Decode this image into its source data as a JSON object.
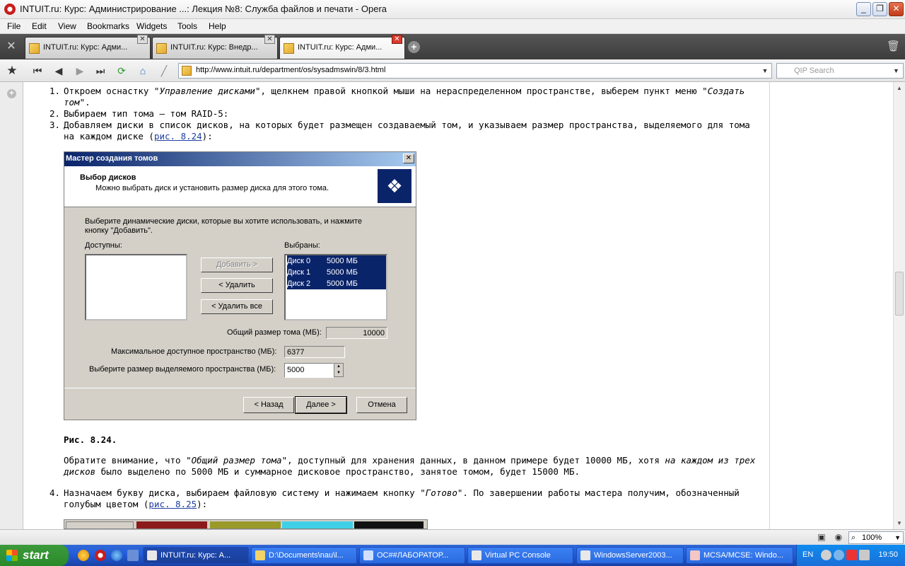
{
  "window": {
    "title": "INTUIT.ru: Курс: Администрирование ...: Лекция №8: Служба файлов и печати - Opera"
  },
  "menu": [
    "File",
    "Edit",
    "View",
    "Bookmarks",
    "Widgets",
    "Tools",
    "Help"
  ],
  "tabs": [
    {
      "label": "INTUIT.ru: Курс: Адми..."
    },
    {
      "label": "INTUIT.ru: Курс: Внедр..."
    },
    {
      "label": "INTUIT.ru: Курс: Адми..."
    }
  ],
  "address": {
    "url": "http://www.intuit.ru/department/os/sysadmswin/8/3.html"
  },
  "search": {
    "placeholder": "QIP Search"
  },
  "content": {
    "item1_a": "Откроем оснастку \"",
    "item1_em": "Управление дисками",
    "item1_b": "\", щелкнем правой кнопкой мыши на нераспределенном пространстве, выберем пункт меню \"",
    "item1_em2": "Создать том",
    "item1_c": "\".",
    "item2": "Выбираем тип тома — том RAID-5:",
    "item3_a": "Добавляем диски в список дисков, на которых будет размещен создаваемый том, и указываем размер пространства, выделяемого для тома на каждом диске (",
    "item3_link": "рис. 8.24",
    "item3_b": "):",
    "caption": "Рис. 8.24.",
    "para_a": "Обратите внимание, что \"",
    "para_em": "Общий размер тома",
    "para_b": "\", доступный для хранения данных, в данном примере будет 10000 МБ, хотя ",
    "para_em2": "на каждом из трех дисков",
    "para_c": " было выделено по 5000 МБ и суммарное дисковое пространство, занятое томом, будет 15000 МБ.",
    "item4_a": "Назначаем букву диска, выбираем файловую систему и нажимаем кнопку \"",
    "item4_em": "Готово",
    "item4_b": "\". По завершении работы мастера получим, обозначенный голубым цветом (",
    "item4_link": "рис. 8.25",
    "item4_c": "):"
  },
  "dialog": {
    "title": "Мастер создания томов",
    "header_title": "Выбор дисков",
    "header_sub": "Можно выбрать диск и установить размер диска для этого тома.",
    "instruction_1": "Выберите динамические диски, которые вы хотите использовать, и нажмите",
    "instruction_2": "кнопку \"Добавить\".",
    "available_label": "Доступны:",
    "selected_label": "Выбраны:",
    "btn_add": "Добавить >",
    "btn_remove": "< Удалить",
    "btn_remove_all": "< Удалить все",
    "selected": [
      {
        "disk": "Диск 0",
        "size": "5000 МБ"
      },
      {
        "disk": "Диск 1",
        "size": "5000 МБ"
      },
      {
        "disk": "Диск 2",
        "size": "5000 МБ"
      }
    ],
    "total_label": "Общий размер тома (МБ):",
    "total_value": "10000",
    "max_label": "Максимальное доступное пространство (МБ):",
    "max_value": "6377",
    "choose_label": "Выберите размер выделяемого пространства (МБ):",
    "choose_value": "5000",
    "btn_back": "< Назад",
    "btn_next": "Далее >",
    "btn_cancel": "Отмена"
  },
  "status": {
    "zoom": "100%"
  },
  "taskbar": {
    "start": "start",
    "items": [
      {
        "label": "INTUIT.ru: Курс: А..."
      },
      {
        "label": "D:\\Documents\\nau\\l..."
      },
      {
        "label": "ОС##ЛАБОРАТОР..."
      },
      {
        "label": "Virtual PC Console"
      },
      {
        "label": "WindowsServer2003..."
      },
      {
        "label": "MCSA/MCSE: Windo..."
      }
    ],
    "lang": "EN",
    "clock": "19:50"
  }
}
